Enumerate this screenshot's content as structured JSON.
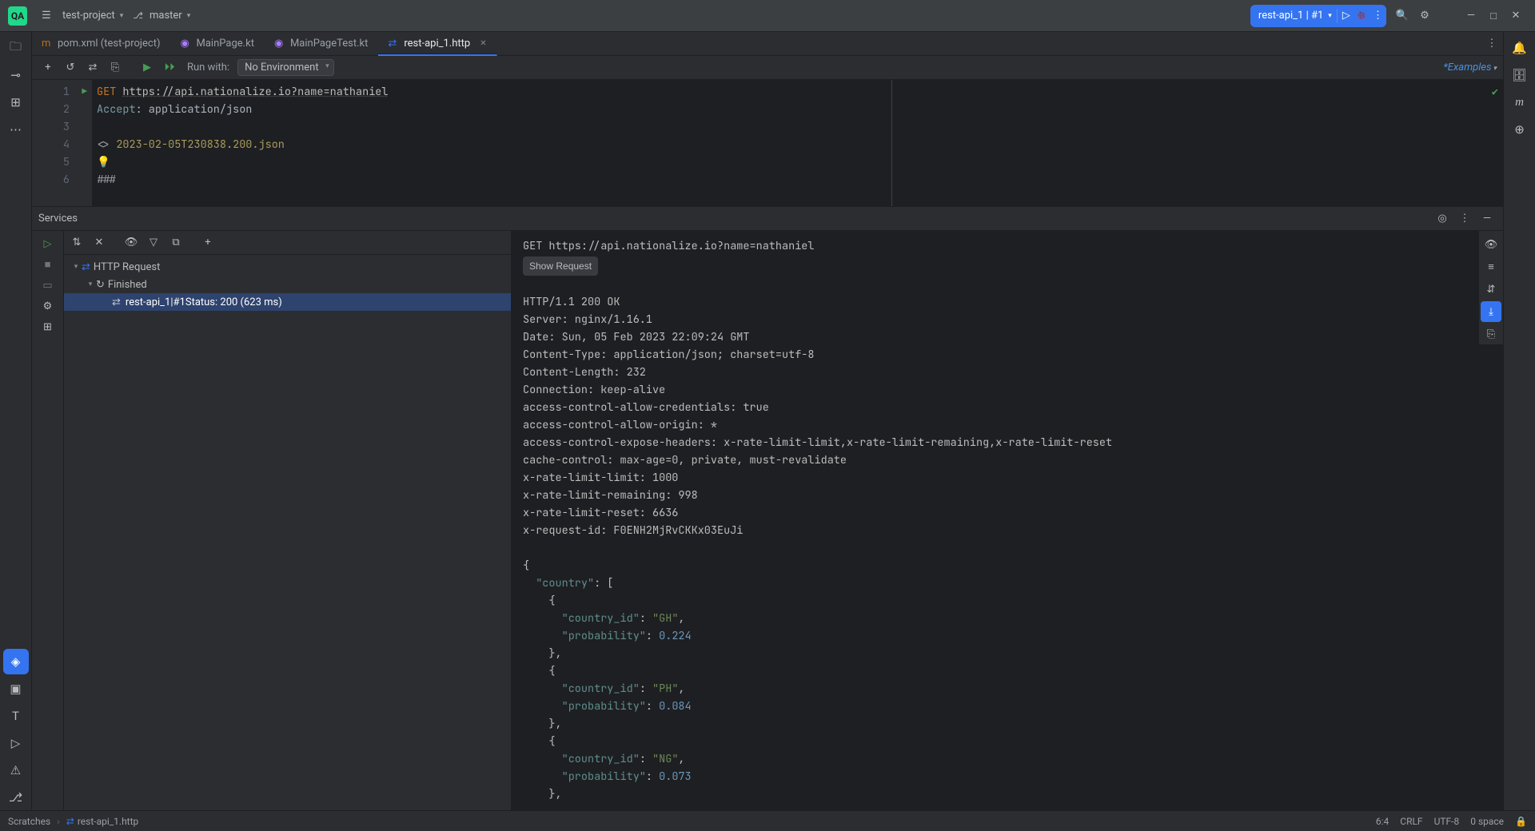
{
  "titlebar": {
    "project": "test-project",
    "branch": "master"
  },
  "run_config": {
    "label": "rest-api_1 | #1"
  },
  "tabs": [
    {
      "icon_color": "#b07219",
      "label": "pom.xml (test-project)"
    },
    {
      "icon_color": "#a97bff",
      "label": "MainPage.kt"
    },
    {
      "icon_color": "#a97bff",
      "label": "MainPageTest.kt"
    },
    {
      "icon_color": "#3574f0",
      "label": "rest-api_1.http",
      "active": true
    }
  ],
  "editor_tb": {
    "run_with": "Run with:",
    "env": "No Environment",
    "examples": "Examples"
  },
  "editor": {
    "l1a": "GET ",
    "l1b": "https://api.nationalize.io?name=nathaniel",
    "l2a": "Accept",
    "l2b": ": application/json",
    "l4pre": "<> ",
    "l4": "2023-02-05T230838.200.json",
    "l6": "###"
  },
  "services": {
    "title": "Services",
    "tree": {
      "root": "HTTP Request",
      "finished": "Finished",
      "run_name": "rest-api_1",
      "run_sep": " | ",
      "run_tag": "#1",
      "run_status": " Status: 200 (623 ms)"
    }
  },
  "response": {
    "first_line": "GET https://api.nationalize.io?name=nathaniel",
    "show_request": "Show Request",
    "headers": "HTTP/1.1 200 OK\nServer: nginx/1.16.1\nDate: Sun, 05 Feb 2023 22:09:24 GMT\nContent-Type: application/json; charset=utf-8\nContent-Length: 232\nConnection: keep-alive\naccess-control-allow-credentials: true\naccess-control-allow-origin: *\naccess-control-expose-headers: x-rate-limit-limit,x-rate-limit-remaining,x-rate-limit-reset\ncache-control: max-age=0, private, must-revalidate\nx-rate-limit-limit: 1000\nx-rate-limit-remaining: 998\nx-rate-limit-reset: 6636\nx-request-id: F0ENH2MjRvCKKx03EuJi",
    "json": {
      "country": [
        {
          "country_id": "GH",
          "probability": 0.224
        },
        {
          "country_id": "PH",
          "probability": 0.084
        },
        {
          "country_id": "NG",
          "probability": 0.073
        }
      ]
    }
  },
  "breadcrumb": {
    "root": "Scratches",
    "file": "rest-api_1.http"
  },
  "statusbar": {
    "caret": "6:4",
    "le": "CRLF",
    "enc": "UTF-8",
    "indent": "0 space"
  }
}
